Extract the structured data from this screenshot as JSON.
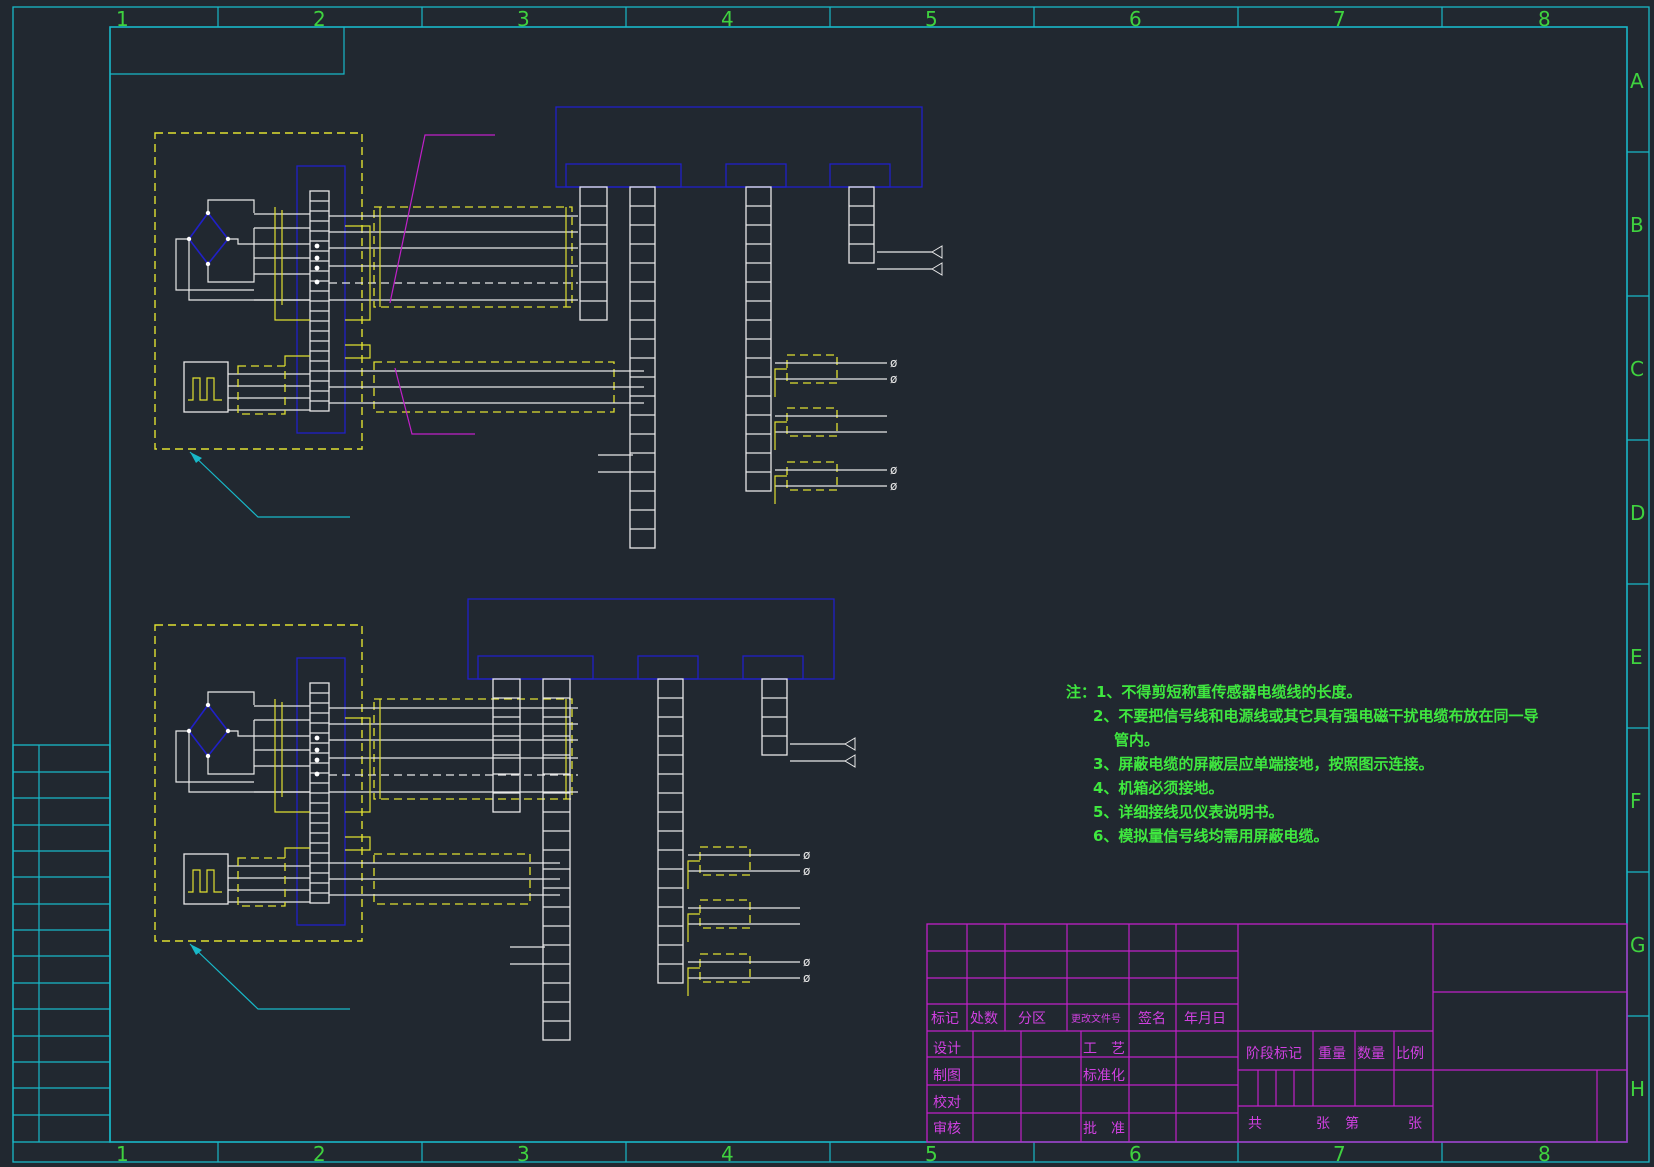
{
  "zones": {
    "columns": [
      "1",
      "2",
      "3",
      "4",
      "5",
      "6",
      "7",
      "8"
    ],
    "rows": [
      "A",
      "B",
      "C",
      "D",
      "E",
      "F",
      "G",
      "H"
    ]
  },
  "notes": [
    "注：1、不得剪短称重传感器电缆线的长度。",
    "2、不要把信号线和电源线或其它具有强电磁干扰电缆布放在同一导",
    "管内。",
    "3、屏蔽电缆的屏蔽层应单端接地，按照图示连接。",
    "4、机箱必须接地。",
    "5、详细接线见仪表说明书。",
    "6、模拟量信号线均需用屏蔽电缆。"
  ],
  "title_block": {
    "revision_headers": [
      "标记",
      "处数",
      "分区",
      "更改文件号",
      "签名",
      "年月日"
    ],
    "sign_roles_left": [
      "设计",
      "制图",
      "校对",
      "审核"
    ],
    "sign_roles_right": [
      "工　艺",
      "标准化",
      "批　准"
    ],
    "stage_headers": [
      "阶段标记",
      "重量",
      "数量",
      "比例"
    ],
    "sheet_count": {
      "total": "共",
      "sheets": "张",
      "number": "第",
      "sheet": "张"
    }
  },
  "colors": {
    "background": "#212830",
    "frame": "#18b8c8",
    "wiring": "#e8e8e8",
    "shield": "#e0e030",
    "enclosure": "#2020c8",
    "leader": "#c020c8",
    "title_block": "#c020c8",
    "zone_text": "#3fd23f",
    "note_text": "#3fe83f"
  },
  "symbols": [
    "bridge-sensor-icon",
    "pulse-generator-icon",
    "ground-terminal-icon",
    "arrow-terminal-icon"
  ]
}
